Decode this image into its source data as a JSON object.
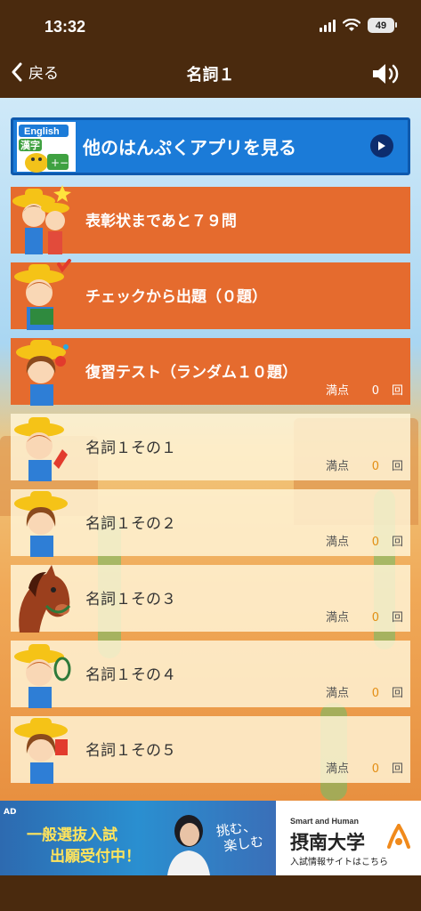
{
  "status_bar": {
    "time": "13:32",
    "battery": "49"
  },
  "nav": {
    "back_label": "戻る",
    "title": "名詞１"
  },
  "banner": {
    "badge_english": "English",
    "badge_kanji": "漢字",
    "text": "他のはんぷくアプリを見る"
  },
  "rows": [
    {
      "label": "表彰状まであと７９問"
    },
    {
      "label": "チェックから出題（０題）"
    },
    {
      "label": "復習テスト（ランダム１０題）",
      "score_label": "満点",
      "score_value": "0",
      "score_unit": "回"
    },
    {
      "label": "名詞１その１",
      "score_label": "満点",
      "score_value": "0",
      "score_unit": "回"
    },
    {
      "label": "名詞１その２",
      "score_label": "満点",
      "score_value": "0",
      "score_unit": "回"
    },
    {
      "label": "名詞１その３",
      "score_label": "満点",
      "score_value": "0",
      "score_unit": "回"
    },
    {
      "label": "名詞１その４",
      "score_label": "満点",
      "score_value": "0",
      "score_unit": "回"
    },
    {
      "label": "名詞１その５",
      "score_label": "満点",
      "score_value": "0",
      "score_unit": "回"
    }
  ],
  "ad": {
    "tag": "AD",
    "line1": "一般選抜入試",
    "line2": "出願受付中！",
    "motto_1": "挑む、",
    "motto_2": "楽しむ",
    "brand": "Smart and Human",
    "university": "摂南大学",
    "subtitle": "入試情報サイトはこちら"
  },
  "icons": {
    "back": "chevron-left-icon",
    "sound": "speaker-icon",
    "wifi": "wifi-icon",
    "signal": "signal-icon",
    "play": "play-icon"
  }
}
